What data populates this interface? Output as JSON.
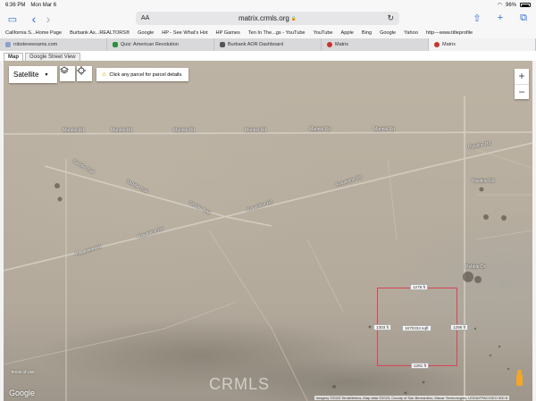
{
  "status": {
    "time": "6:36 PM",
    "date": "Mon Mar 6",
    "battery": "96%"
  },
  "browser": {
    "aa": "AA",
    "url": "matrix.crmls.org",
    "lock": "🔒",
    "reload": "↻",
    "back": "‹",
    "forward": "›",
    "sidebar": "▭",
    "share": "⇧",
    "new_tab": "+",
    "tabs_overview": "⧉"
  },
  "bookmarks": [
    "California S...Home Page",
    "Burbank As...REALTORS®",
    "Google",
    "HP - See What's Hot",
    "HP Games",
    "Ten In The...gs - YouTube",
    "YouTube",
    "Apple",
    "Bing",
    "Google",
    "Yahoo",
    "http---www.titleprofile"
  ],
  "tabs": [
    {
      "label": "robsteveexams.com",
      "color": "#8aa2c8"
    },
    {
      "label": "Quiz: American Revolution",
      "color": "#2f8f3e"
    },
    {
      "label": "Burbank AOR Dashboard",
      "color": "#555555"
    },
    {
      "label": "Matrix",
      "color": "#c9332b"
    },
    {
      "label": "Matrix",
      "color": "#c9332b"
    }
  ],
  "map_tabs": [
    "Map",
    "Google Street View"
  ],
  "map_controls": {
    "map_type": "Satellite",
    "hint": "Click any parcel for parcel details.",
    "zoom_in": "+",
    "zoom_out": "−"
  },
  "road_labels": {
    "mannix_1": "Mannix Rd",
    "mannix_2": "Mannix Rd",
    "mannix_3": "Mannix Rd",
    "mannix_4": "Mannix Rd",
    "mannix_5": "Mannix Rd",
    "mannix_6": "Mannix Rd",
    "pipeline_1": "Pipeline Rd",
    "pipeline_2": "Pipeline Rd",
    "powerline_1": "Powerline Rd",
    "powerline_2": "Powerline Rd",
    "powerline_3": "Powerline Rd",
    "powerline_4": "Powerline Rd",
    "saddle_1": "Saddle Trail",
    "saddle_2": "Saddle Trail",
    "saddle_3": "Saddle Trail",
    "place": "Pebble Dr"
  },
  "parcel": {
    "top": "1278 ft",
    "left": "1303 ft",
    "area": "1670234 sqft",
    "right": "1298 ft",
    "bottom": "1281 ft",
    "outline_color": "#d94455"
  },
  "footer": {
    "google": "Google",
    "watermark": "CRMLS",
    "attribution": "Imagery ©2023 TerraMetrics, Map data ©2023, County of San Bernardino, Maxar Technologies, USDA/FPAC/GEO   500 ft",
    "terms": "Terms of Use"
  }
}
